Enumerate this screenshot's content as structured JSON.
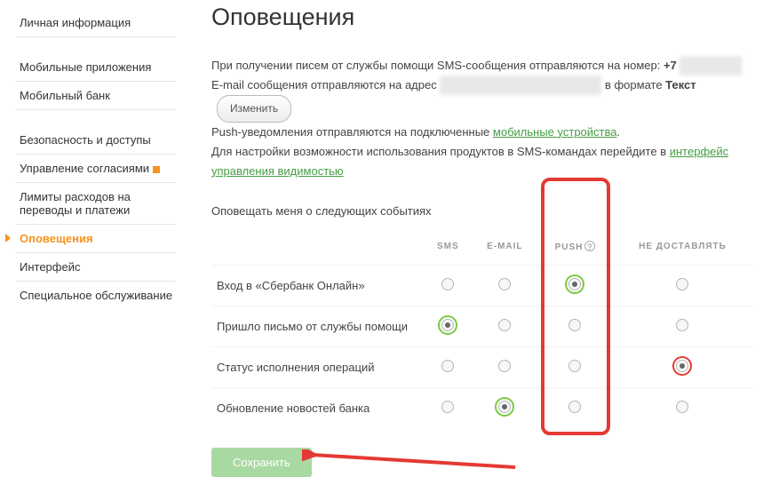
{
  "sidebar": {
    "items": [
      {
        "label": "Личная информация"
      },
      {
        "label": "Мобильные приложения"
      },
      {
        "label": "Мобильный банк"
      },
      {
        "label": "Безопасность и доступы"
      },
      {
        "label": "Управление согласиями"
      },
      {
        "label": "Лимиты расходов на переводы и платежи"
      },
      {
        "label": "Оповещения"
      },
      {
        "label": "Интерфейс"
      },
      {
        "label": "Специальное обслуживание"
      }
    ]
  },
  "page": {
    "title": "Оповещения",
    "intro_sms_prefix": "При получении писем от службы помощи SMS-сообщения отправляются на номер: ",
    "phone_prefix": "+7",
    "phone_hidden": "XXXXXXXX",
    "intro_email_prefix": "E-mail сообщения отправляются на адрес ",
    "email_hidden": "xxxxxxxxxxxxxxxxxxxxxxxxxxxx",
    "intro_email_suffix": " в формате ",
    "email_format": "Текст",
    "change_btn": "Изменить",
    "push_line_prefix": "Push-уведомления отправляются на подключенные ",
    "push_link": "мобильные устройства",
    "visibility_prefix": "Для настройки возможности использования продуктов в SMS-командах перейдите в ",
    "visibility_link": "интерфейс управления видимостью",
    "section_label": "Оповещать меня о следующих событиях"
  },
  "table": {
    "headers": [
      "",
      "SMS",
      "E-MAIL",
      "PUSH",
      "НЕ ДОСТАВЛЯТЬ"
    ],
    "rows": [
      {
        "label": "Вход в «Сбербанк Онлайн»",
        "selected": "push"
      },
      {
        "label": "Пришло письмо от службы помощи",
        "selected": "sms"
      },
      {
        "label": "Статус исполнения операций",
        "selected": "none_red"
      },
      {
        "label": "Обновление новостей банка",
        "selected": "email"
      }
    ]
  },
  "save_btn": "Сохранить"
}
